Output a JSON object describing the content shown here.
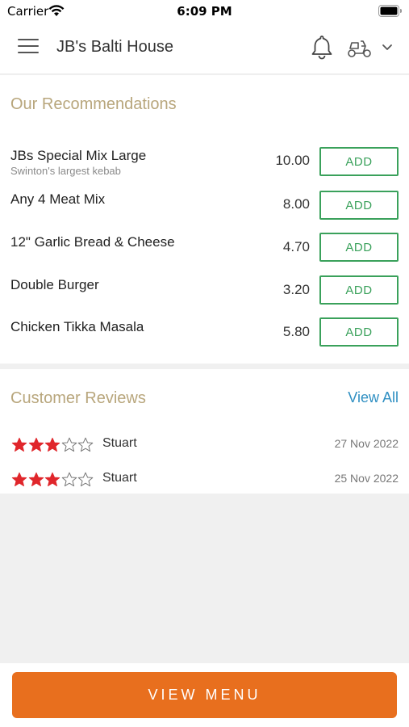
{
  "status_bar": {
    "carrier": "Carrier",
    "time": "6:09 PM"
  },
  "header": {
    "title": "JB's Balti House",
    "icons": [
      "hamburger-menu-icon",
      "bell-icon",
      "scooter-icon",
      "chevron-down-icon"
    ]
  },
  "recommendations": {
    "title": "Our Recommendations",
    "items": [
      {
        "name": "JBs Special Mix Large",
        "description": "Swinton's largest kebab",
        "price": "10.00",
        "button": "ADD"
      },
      {
        "name": "Any 4 Meat Mix",
        "description": "",
        "price": "8.00",
        "button": "ADD"
      },
      {
        "name": "12\" Garlic Bread & Cheese",
        "description": "",
        "price": "4.70",
        "button": "ADD"
      },
      {
        "name": "Double Burger",
        "description": "",
        "price": "3.20",
        "button": "ADD"
      },
      {
        "name": "Chicken Tikka Masala",
        "description": "",
        "price": "5.80",
        "button": "ADD"
      }
    ]
  },
  "reviews": {
    "title": "Customer Reviews",
    "view_all": "View All",
    "items": [
      {
        "name": "Stuart",
        "rating": 3,
        "max_rating": 5,
        "date": "27 Nov 2022"
      },
      {
        "name": "Stuart",
        "rating": 3,
        "max_rating": 5,
        "date": "25 Nov 2022"
      }
    ]
  },
  "footer": {
    "button": "VIEW MENU"
  },
  "colors": {
    "accent_orange": "#e86f1e",
    "add_green": "#3aa15b",
    "section_title": "#b8a67c",
    "link_blue": "#2f8fc2",
    "star_red": "#e0262b"
  }
}
